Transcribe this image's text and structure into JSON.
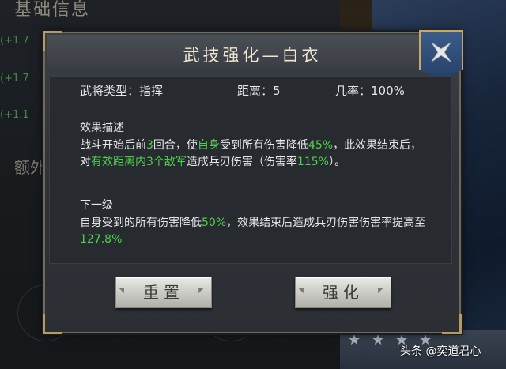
{
  "background": {
    "title": "基础信息",
    "lines": [
      "(+1.7",
      "(+1.7",
      "(+1.1"
    ],
    "extra": "额外"
  },
  "dialog": {
    "title": "武技强化—白衣",
    "close_icon": "close-x-icon",
    "stats": {
      "type_label": "武将类型：",
      "type_value": "指挥",
      "range_label": "距离：",
      "range_value": "5",
      "chance_label": "几率：",
      "chance_value": "100%"
    },
    "effect_label": "效果描述",
    "effect": {
      "p1": "战斗开始后前",
      "n1": "3",
      "p2": "回合，使",
      "n2": "自身",
      "p3": "受到所有伤害降低",
      "n3": "45%",
      "p4": "，此效果结束后，对",
      "n4": "有效距离内3个敌军",
      "p5": "造成兵刃伤害（伤害率",
      "n5": "115%",
      "p6": "）。"
    },
    "next_label": "下一级",
    "next": {
      "p1": "自身受到的所有伤害降低",
      "n1": "50%",
      "p2": "，效果结束后造成兵刃伤害伤害率提高至",
      "n2": "127.8%"
    },
    "buttons": {
      "reset": "重置",
      "enhance": "强化"
    }
  },
  "watermark": "头条 @奕道君心",
  "colors": {
    "highlight": "#4fd04f",
    "accent_gold": "#c8a95e",
    "close_blue": "#2f4f7c"
  }
}
